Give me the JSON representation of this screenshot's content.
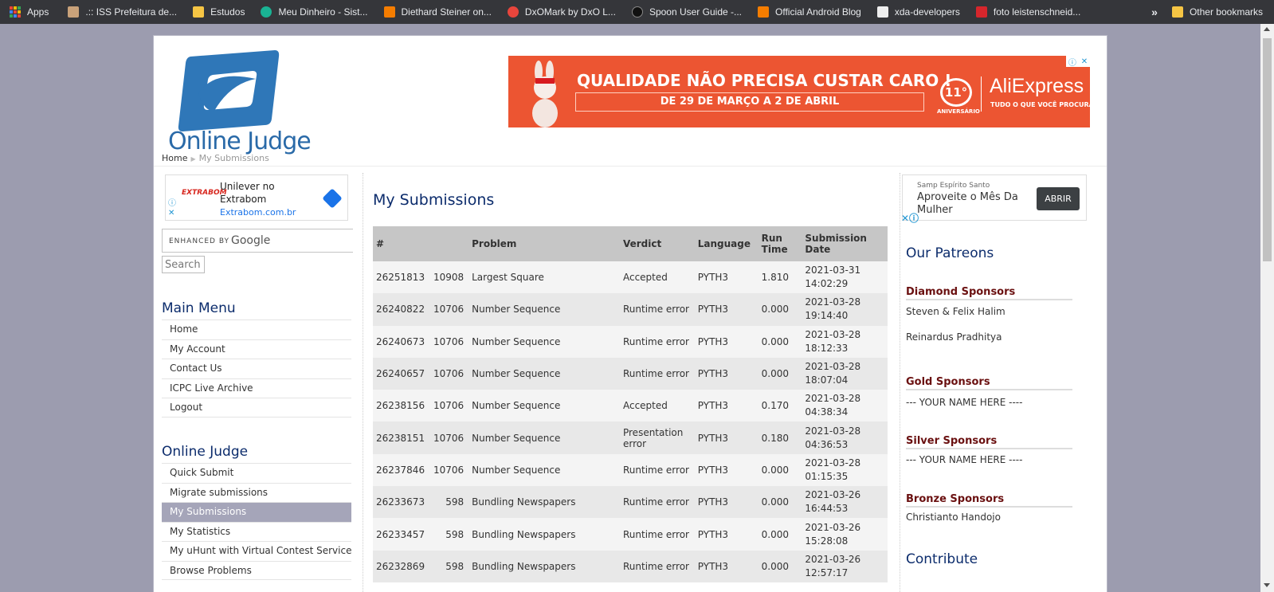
{
  "bookmarks": {
    "items": [
      {
        "label": "Apps",
        "icon": "apps-grid-icon",
        "color": "#ea4335"
      },
      {
        "label": ".:: ISS Prefeitura de...",
        "icon": "site-favicon-icon",
        "color": "#c9a27a"
      },
      {
        "label": "Estudos",
        "icon": "folder-icon",
        "color": "#f6c544"
      },
      {
        "label": "Meu Dinheiro - Sist...",
        "icon": "leaf-icon",
        "color": "#1ab394"
      },
      {
        "label": "Diethard Steiner on...",
        "icon": "blogger-icon",
        "color": "#f57d00"
      },
      {
        "label": "DxOMark by DxO L...",
        "icon": "dxo-icon",
        "color": "#e8453c"
      },
      {
        "label": "Spoon User Guide -...",
        "icon": "spoon-icon",
        "color": "#111111"
      },
      {
        "label": "Official Android Blog",
        "icon": "blogger-icon",
        "color": "#f57d00"
      },
      {
        "label": "xda-developers",
        "icon": "xda-icon",
        "color": "#eeeeee"
      },
      {
        "label": "foto leistenschneid...",
        "icon": "photo-icon",
        "color": "#d6262c"
      }
    ],
    "overflow": "»",
    "other": "Other bookmarks"
  },
  "header": {
    "logo_text": "Online Judge",
    "breadcrumb": {
      "home": "Home",
      "current": "My Submissions"
    }
  },
  "banner": {
    "title": "QUALIDADE NÃO PRECISA CUSTAR CARO !",
    "subtitle": "DE 29 DE MARÇO A 2 DE ABRIL",
    "anniversary": "11°",
    "anniversary_label": "ANIVERSÁRIO",
    "brand": "AliExpress",
    "tagline": "TUDO O QUE VOCÊ PROCURA"
  },
  "left_ad": {
    "logo": "EXTRABOM",
    "title": "Unilever no Extrabom",
    "url": "Extrabom.com.br"
  },
  "search": {
    "enhanced": "ENHANCED BY",
    "google": "Google",
    "button": "Search"
  },
  "main_menu": {
    "title": "Main Menu",
    "items": [
      "Home",
      "My Account",
      "Contact Us",
      "ICPC Live Archive",
      "Logout"
    ]
  },
  "oj_menu": {
    "title": "Online Judge",
    "items": [
      "Quick Submit",
      "Migrate submissions",
      "My Submissions",
      "My Statistics",
      "My uHunt with Virtual Contest Service",
      "Browse Problems"
    ],
    "active_index": 2
  },
  "submissions": {
    "title": "My Submissions",
    "columns": [
      "#",
      "Problem",
      "Verdict",
      "Language",
      "Run Time",
      "Submission Date"
    ],
    "rows": [
      {
        "id": "26251813",
        "pid": "10908",
        "name": "Largest Square",
        "verdict": "Accepted",
        "lang": "PYTH3",
        "time": "1.810",
        "date1": "2021-03-31",
        "date2": "14:02:29"
      },
      {
        "id": "26240822",
        "pid": "10706",
        "name": "Number Sequence",
        "verdict": "Runtime error",
        "lang": "PYTH3",
        "time": "0.000",
        "date1": "2021-03-28",
        "date2": "19:14:40"
      },
      {
        "id": "26240673",
        "pid": "10706",
        "name": "Number Sequence",
        "verdict": "Runtime error",
        "lang": "PYTH3",
        "time": "0.000",
        "date1": "2021-03-28",
        "date2": "18:12:33"
      },
      {
        "id": "26240657",
        "pid": "10706",
        "name": "Number Sequence",
        "verdict": "Runtime error",
        "lang": "PYTH3",
        "time": "0.000",
        "date1": "2021-03-28",
        "date2": "18:07:04"
      },
      {
        "id": "26238156",
        "pid": "10706",
        "name": "Number Sequence",
        "verdict": "Accepted",
        "lang": "PYTH3",
        "time": "0.170",
        "date1": "2021-03-28",
        "date2": "04:38:34"
      },
      {
        "id": "26238151",
        "pid": "10706",
        "name": "Number Sequence",
        "verdict": "Presentation error",
        "lang": "PYTH3",
        "time": "0.180",
        "date1": "2021-03-28",
        "date2": "04:36:53"
      },
      {
        "id": "26237846",
        "pid": "10706",
        "name": "Number Sequence",
        "verdict": "Runtime error",
        "lang": "PYTH3",
        "time": "0.000",
        "date1": "2021-03-28",
        "date2": "01:15:35"
      },
      {
        "id": "26233673",
        "pid": "598",
        "name": "Bundling Newspapers",
        "verdict": "Runtime error",
        "lang": "PYTH3",
        "time": "0.000",
        "date1": "2021-03-26",
        "date2": "16:44:53"
      },
      {
        "id": "26233457",
        "pid": "598",
        "name": "Bundling Newspapers",
        "verdict": "Runtime error",
        "lang": "PYTH3",
        "time": "0.000",
        "date1": "2021-03-26",
        "date2": "15:28:08"
      },
      {
        "id": "26232869",
        "pid": "598",
        "name": "Bundling Newspapers",
        "verdict": "Runtime error",
        "lang": "PYTH3",
        "time": "0.000",
        "date1": "2021-03-26",
        "date2": "12:57:17"
      }
    ]
  },
  "right_ad": {
    "sponsor": "Samp Espírito Santo",
    "title": "Aproveite o Mês Da Mulher",
    "button": "ABRIR"
  },
  "patreons": {
    "title": "Our Patreons",
    "diamond": {
      "title": "Diamond Sponsors",
      "names": [
        "Steven & Felix Halim",
        "Reinardus Pradhitya"
      ]
    },
    "gold": {
      "title": "Gold Sponsors",
      "names": [
        "--- YOUR NAME HERE ----"
      ]
    },
    "silver": {
      "title": "Silver Sponsors",
      "names": [
        "--- YOUR NAME HERE ----"
      ]
    },
    "bronze": {
      "title": "Bronze Sponsors",
      "names": [
        "Christianto Handojo"
      ]
    },
    "contribute": "Contribute"
  },
  "colors": {
    "accent_red": "#a00000",
    "title_blue": "#0c2c6c",
    "active_menu": "#a5a5b9",
    "banner_orange": "#ec5532"
  }
}
